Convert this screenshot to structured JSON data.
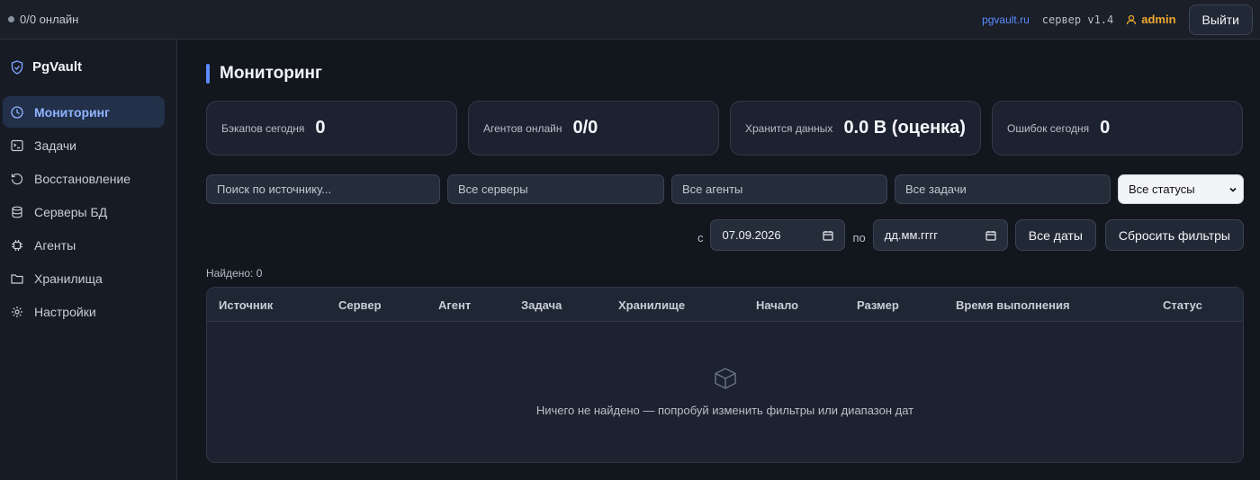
{
  "topbar": {
    "online": "0/0 онлайн",
    "site_link": "pgvault.ru",
    "version": "сервер v1.4",
    "user": "admin",
    "logout": "Выйти"
  },
  "sidebar": {
    "brand": "PgVault",
    "items": [
      {
        "label": "Мониторинг",
        "icon": "clock-icon",
        "active": true
      },
      {
        "label": "Задачи",
        "icon": "terminal-icon"
      },
      {
        "label": "Восстановление",
        "icon": "restore-icon"
      },
      {
        "label": "Серверы БД",
        "icon": "database-icon"
      },
      {
        "label": "Агенты",
        "icon": "chip-icon"
      },
      {
        "label": "Хранилища",
        "icon": "folder-icon"
      },
      {
        "label": "Настройки",
        "icon": "gear-icon"
      }
    ]
  },
  "main": {
    "title": "Мониторинг",
    "cards": [
      {
        "label": "Бэкапов сегодня",
        "value": "0"
      },
      {
        "label": "Агентов онлайн",
        "value": "0/0"
      },
      {
        "label": "Хранится данных",
        "value": "0.0 B (оценка)"
      },
      {
        "label": "Ошибок сегодня",
        "value": "0"
      }
    ],
    "filters": {
      "search_placeholder": "Поиск по источнику...",
      "servers": "Все серверы",
      "agents": "Все агенты",
      "tasks": "Все задачи",
      "status": "Все статусы"
    },
    "dates": {
      "from_label": "с",
      "from_value": "07.09.2026",
      "to_label": "по",
      "to_value": "дд.мм.гггг",
      "all_dates": "Все даты",
      "reset": "Сбросить фильтры"
    },
    "found": "Найдено: 0",
    "table": {
      "columns": [
        "Источник",
        "Сервер",
        "Агент",
        "Задача",
        "Хранилище",
        "Начало",
        "Размер",
        "Время выполнения",
        "Статус"
      ],
      "empty": "Ничего не найдено — попробуй изменить фильтры или диапазон дат"
    }
  },
  "colors": {
    "accent": "#5b8cff",
    "user": "#f0a830",
    "background": "#12161d"
  }
}
